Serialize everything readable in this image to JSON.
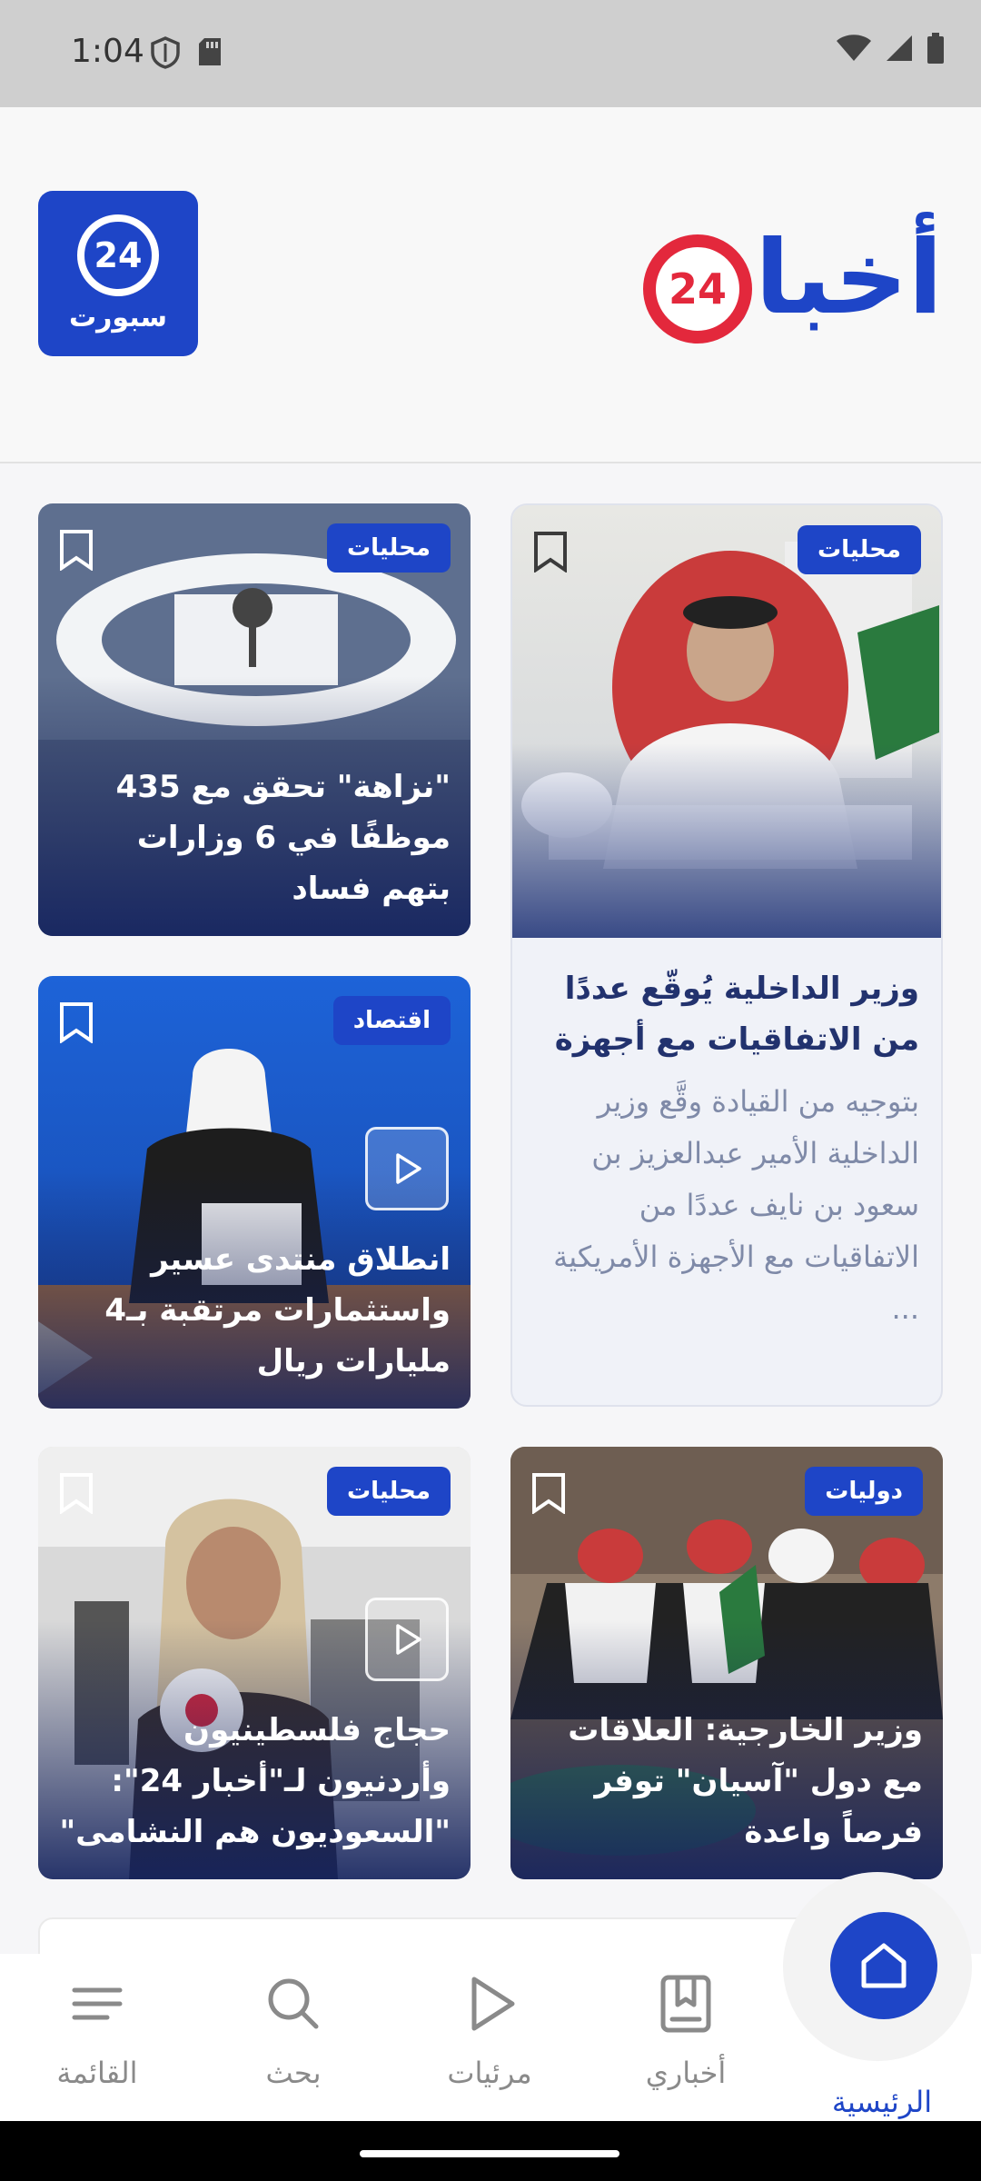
{
  "status_bar": {
    "time": "1:04"
  },
  "header": {
    "sport_logo_number": "24",
    "sport_logo_text": "سبورت",
    "main_logo_text": "أخبار",
    "main_logo_number": "24"
  },
  "articles": [
    {
      "badge": "محليات",
      "title": "\"نزاهة\" تحقق مع 435 موظفًا في 6 وزارات بتهم فساد"
    },
    {
      "badge": "اقتصاد",
      "title": "انطلاق منتدى عسير واستثمارات مرتقبة بـ4 مليارات ريال"
    },
    {
      "badge": "محليات",
      "title": "حجاج فلسطينيون وأردنيون لـ\"أخبار 24\": \"السعوديون هم النشامى\""
    },
    {
      "badge": "دوليات",
      "title": "وزير الخارجية: العلاقات مع دول \"آسيان\" توفر فرصاً واعدة"
    }
  ],
  "featured": {
    "badge": "محليات",
    "title": "وزير الداخلية يُوقّع عددًا من الاتفاقيات مع أجهزة",
    "description": "بتوجيه من القيادة وقَّع وزير الداخلية الأمير عبدالعزيز بن سعود بن نايف عددًا من الاتفاقيات مع الأجهزة الأمريكية ..."
  },
  "bottom_nav": {
    "items": [
      {
        "label": "القائمة"
      },
      {
        "label": "بحث"
      },
      {
        "label": "مرئيات"
      },
      {
        "label": "أخباري"
      },
      {
        "label": "الرئيسية"
      }
    ]
  },
  "colors": {
    "brand_blue": "#1e45c7",
    "brand_red": "#e3283c",
    "nav_inactive": "#8a8a8a"
  }
}
